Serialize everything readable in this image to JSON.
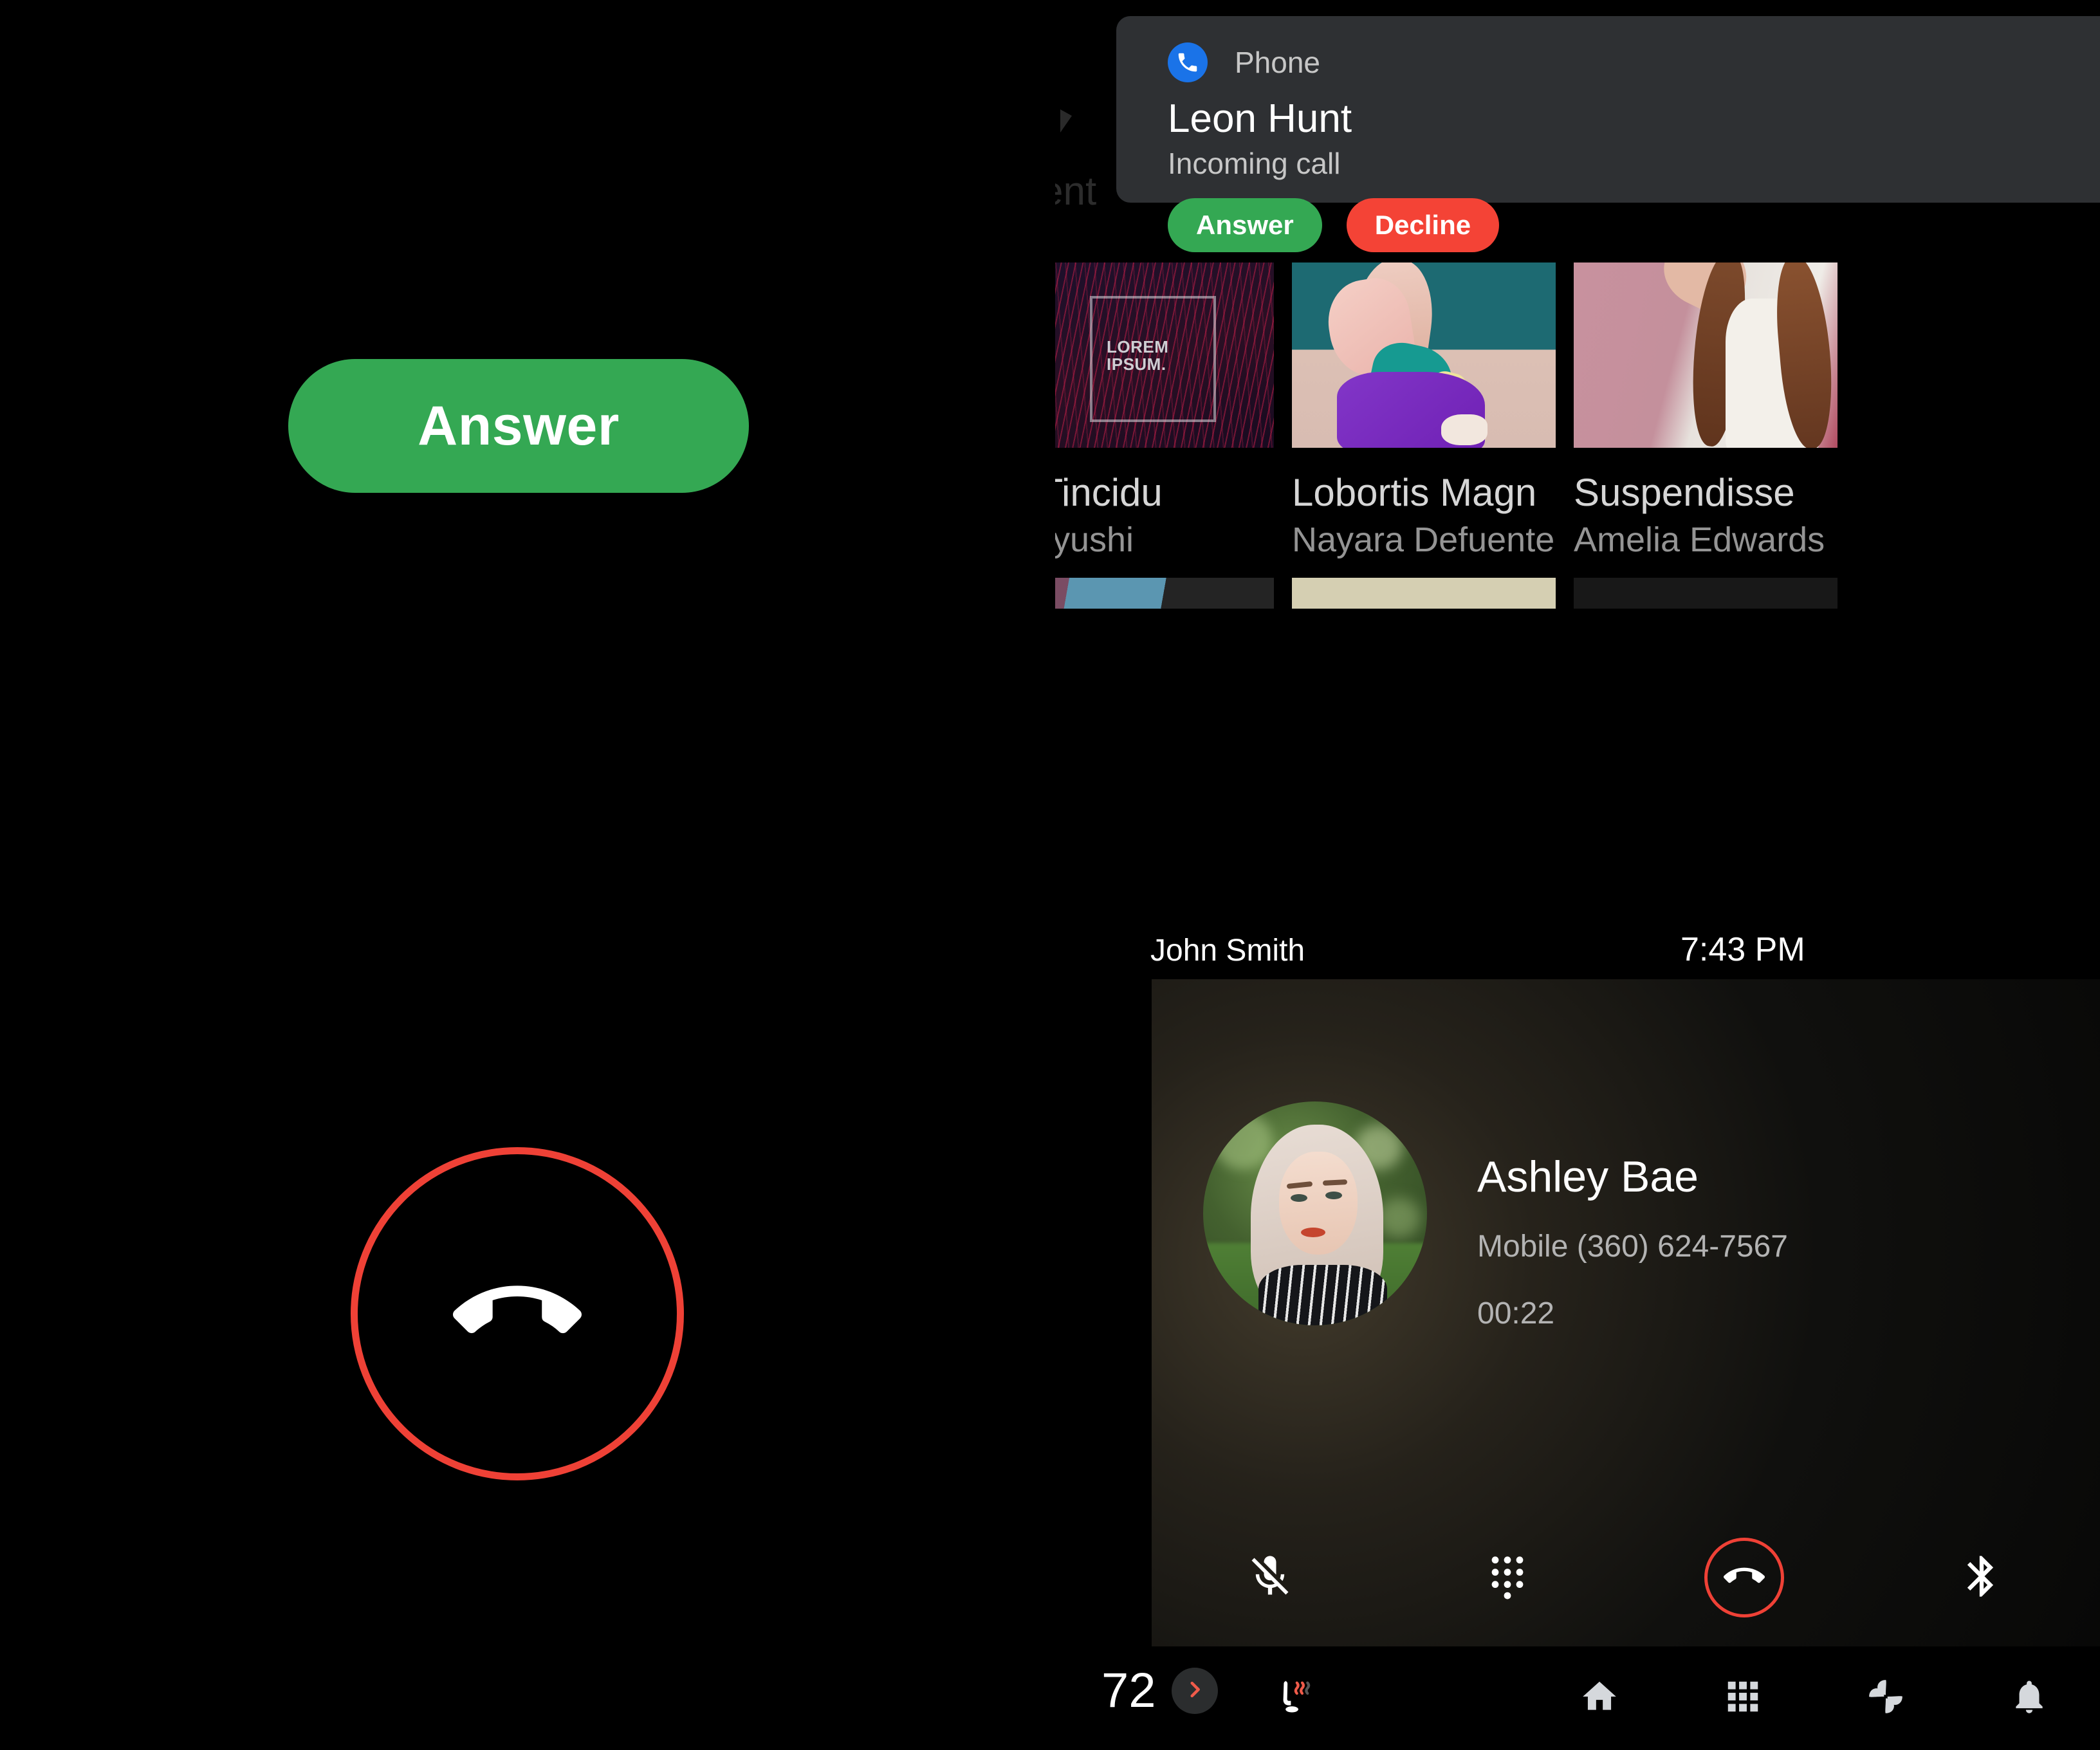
{
  "left_panel": {
    "answer_button_label": "Answer",
    "hangup_icon": "call-end-icon"
  },
  "right_panel": {
    "ghost_text": "ent",
    "media_cards": [
      {
        "title": "s Tincidu",
        "artist": "i Ryushi",
        "art": "lorem-ipsum-poster",
        "lorem_line1": "LOREM",
        "lorem_line2": "IPSUM."
      },
      {
        "title": "Lobortis Magn",
        "artist": "Nayara Defuente",
        "art": "fashion-photo"
      },
      {
        "title": "Suspendisse",
        "artist": "Amelia Edwards",
        "art": "portrait-photo"
      }
    ],
    "status": {
      "user": "John Smith",
      "time": "7:43 PM"
    },
    "call_card": {
      "contact_name": "Ashley Bae",
      "phone_label": "Mobile (360) 624-7567",
      "duration": "00:22",
      "avatar_alt": "ashley-bae-avatar",
      "controls": [
        {
          "name": "mute-icon",
          "label": "Mute"
        },
        {
          "name": "dialpad-icon",
          "label": "Dialpad"
        },
        {
          "name": "call-end-icon",
          "label": "End call"
        },
        {
          "name": "bluetooth-icon",
          "label": "Bluetooth"
        }
      ]
    },
    "nav_bar": {
      "temperature": "72",
      "chevron_icon": "chevron-right-icon",
      "seat_heater_icon": "heated-seat-icon",
      "items": [
        {
          "name": "home-icon",
          "label": "Home"
        },
        {
          "name": "apps-grid-icon",
          "label": "Apps"
        },
        {
          "name": "climate-fan-icon",
          "label": "Climate"
        },
        {
          "name": "notification-bell-icon",
          "label": "Notifications"
        }
      ]
    }
  },
  "notification": {
    "app_name": "Phone",
    "app_icon": "phone-icon",
    "caller_name": "Leon Hunt",
    "status_text": "Incoming call",
    "answer_label": "Answer",
    "decline_label": "Decline"
  },
  "colors": {
    "answer_green": "#34a853",
    "decline_red": "#f44336",
    "hangup_red": "#ef4136",
    "panel_bg": "#2e3033",
    "app_blue": "#1a73e8",
    "screen_bg": "#000000"
  }
}
